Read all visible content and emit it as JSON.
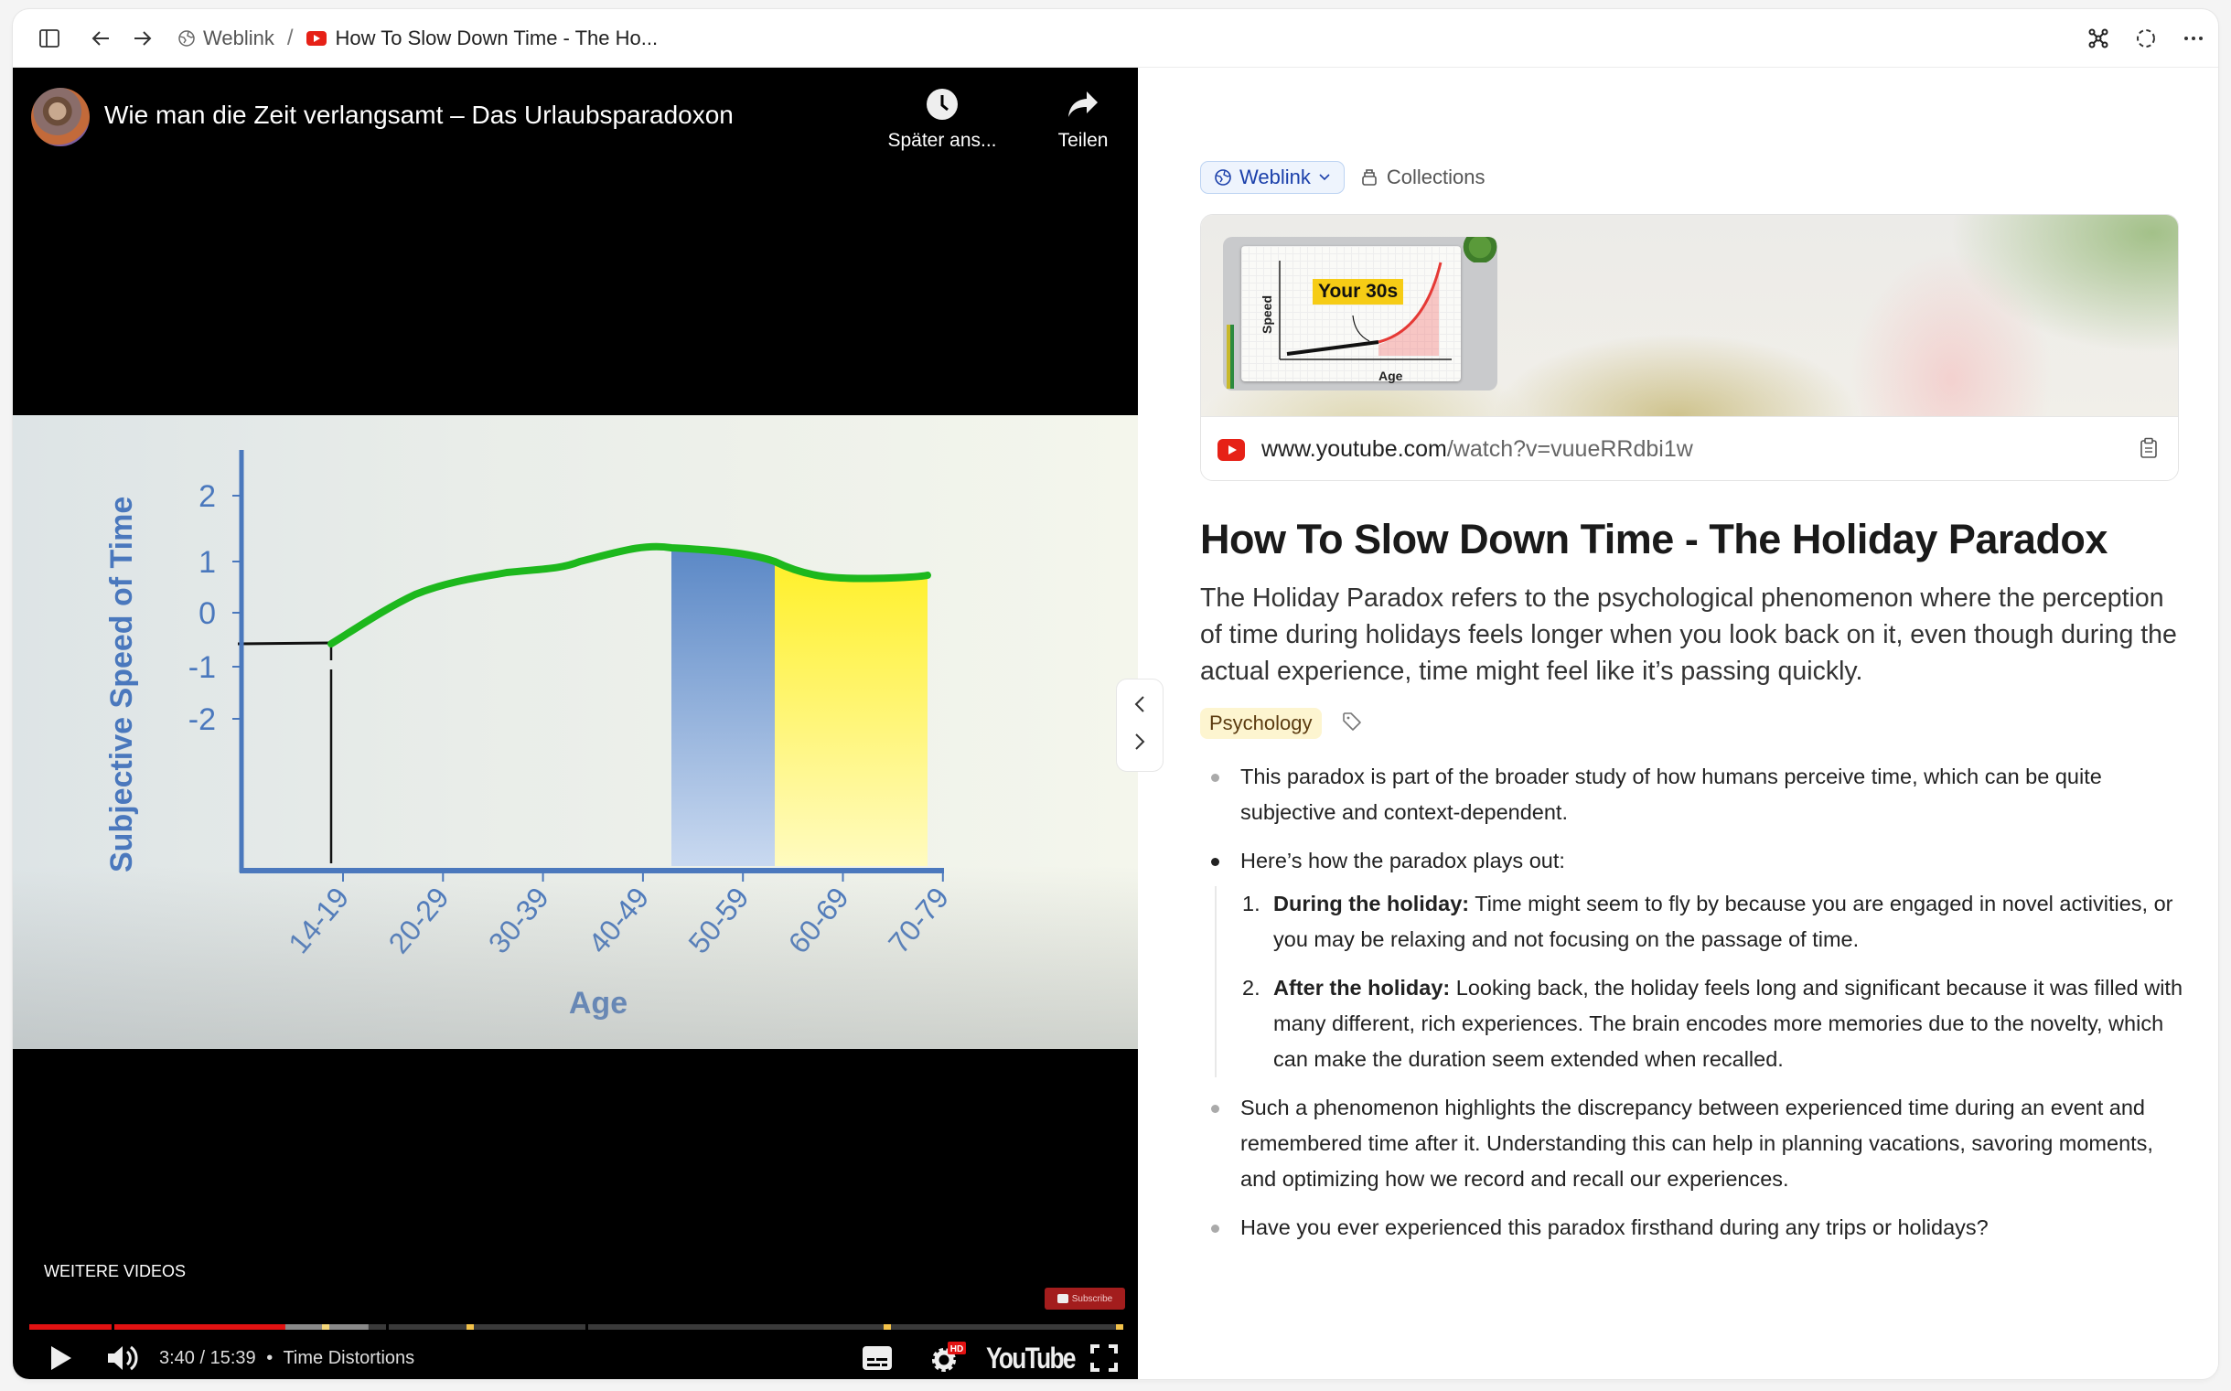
{
  "toolbar": {
    "breadcrumb_root": "Weblink",
    "breadcrumb_separator": "/",
    "breadcrumb_current": "How To Slow Down Time - The Ho..."
  },
  "video": {
    "title": "Wie man die Zeit verlangsamt – Das Urlaubsparadoxon",
    "actions": [
      {
        "label": "Später ans...",
        "icon": "clock-icon"
      },
      {
        "label": "Teilen",
        "icon": "share-icon"
      }
    ],
    "more_videos": "WEITERE VIDEOS",
    "subscribe": "Subscribe",
    "current_time": "3:40",
    "duration": "15:39",
    "time_display": "3:40 / 15:39",
    "chapter": "Time Distortions",
    "played_fraction": 0.234,
    "buffered_fraction": 0.31,
    "youtube_logo": "YouTube",
    "hd_badge": "HD",
    "frame_chart": {
      "ylabel": "Subjective Speed of Time",
      "xlabel": "Age",
      "yticks": [
        "2",
        "1",
        "0",
        "-1",
        "-2"
      ],
      "xticks": [
        "14-19",
        "20-29",
        "30-39",
        "40-49",
        "50-59",
        "60-69",
        "70-79"
      ]
    }
  },
  "panel": {
    "type_pill": "Weblink",
    "collections": "Collections",
    "card": {
      "thumb_label": "Your 30s",
      "thumb_y": "Speed",
      "thumb_x": "Age",
      "url_domain": "www.youtube.com",
      "url_path": "/watch?v=vuueRRdbi1w"
    },
    "title": "How To Slow Down Time - The Holiday Paradox",
    "summary": "The Holiday Paradox refers to the psychological phenomenon where the perception of time during holidays feels longer when you look back on it, even though during the actual experience, time might feel like it’s passing quickly.",
    "tag": "Psychology",
    "bullets": [
      "This paradox is part of the broader study of how humans perceive time, which can be quite subjective and context-dependent.",
      "Here’s how the paradox plays out:"
    ],
    "numbered": [
      {
        "num": "1.",
        "bold": "During the holiday:",
        "text": " Time might seem to fly by because you are engaged in novel activities, or you may be relaxing and not focusing on the passage of time."
      },
      {
        "num": "2.",
        "bold": "After the holiday:",
        "text": " Looking back, the holiday feels long and significant because it was filled with many different, rich experiences. The brain encodes more memories due to the novelty, which can make the duration seem extended when recalled."
      }
    ],
    "bullets_after": [
      "Such a phenomenon highlights the discrepancy between experienced time during an event and remembered time after it. Understanding this can help in planning vacations, savoring moments, and optimizing how we record and recall our experiences.",
      "Have you ever experienced this paradox firsthand during any trips or holidays?"
    ]
  }
}
